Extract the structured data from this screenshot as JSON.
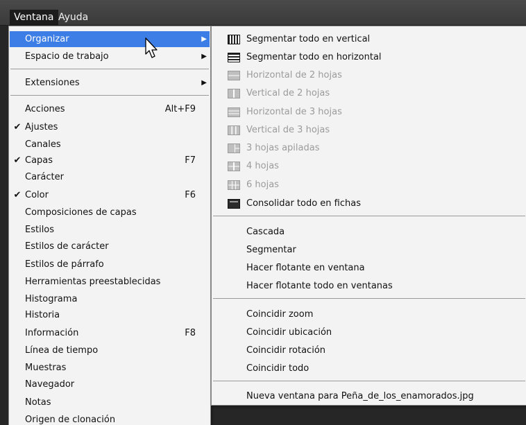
{
  "menubar": {
    "items": [
      "Ventana",
      "Ayuda"
    ]
  },
  "window_menu": {
    "items": [
      {
        "label": "Organizar",
        "submenu": true,
        "highlighted": true
      },
      {
        "label": "Espacio de trabajo",
        "submenu": true
      },
      {
        "label": "Extensiones",
        "submenu": true
      },
      {
        "label": "Acciones",
        "shortcut": "Alt+F9"
      },
      {
        "label": "Ajustes",
        "checked": true
      },
      {
        "label": "Canales"
      },
      {
        "label": "Capas",
        "checked": true,
        "shortcut": "F7"
      },
      {
        "label": "Carácter"
      },
      {
        "label": "Color",
        "checked": true,
        "shortcut": "F6"
      },
      {
        "label": "Composiciones de capas"
      },
      {
        "label": "Estilos"
      },
      {
        "label": "Estilos de carácter"
      },
      {
        "label": "Estilos de párrafo"
      },
      {
        "label": "Herramientas preestablecidas"
      },
      {
        "label": "Histograma"
      },
      {
        "label": "Historia"
      },
      {
        "label": "Información",
        "shortcut": "F8"
      },
      {
        "label": "Línea de tiempo"
      },
      {
        "label": "Muestras"
      },
      {
        "label": "Navegador"
      },
      {
        "label": "Notas"
      },
      {
        "label": "Origen de clonación"
      }
    ],
    "check_mark": "✔",
    "submenu_arrow": "▶"
  },
  "arrange_submenu": {
    "items": [
      {
        "label": "Segmentar todo en vertical",
        "icon": "vertical-tile-icon"
      },
      {
        "label": "Segmentar todo en horizontal",
        "icon": "horizontal-tile-icon"
      },
      {
        "label": "Horizontal de 2 hojas",
        "icon": "two-up-horizontal-icon",
        "disabled": true
      },
      {
        "label": "Vertical de 2 hojas",
        "icon": "two-up-vertical-icon",
        "disabled": true
      },
      {
        "label": "Horizontal de 3 hojas",
        "icon": "three-up-horizontal-icon",
        "disabled": true
      },
      {
        "label": "Vertical de 3 hojas",
        "icon": "three-up-vertical-icon",
        "disabled": true
      },
      {
        "label": "3 hojas apiladas",
        "icon": "three-up-stacked-icon",
        "disabled": true
      },
      {
        "label": "4 hojas",
        "icon": "four-up-icon",
        "disabled": true
      },
      {
        "label": "6 hojas",
        "icon": "six-up-icon",
        "disabled": true
      },
      {
        "label": "Consolidar todo en fichas",
        "icon": "consolidate-tabs-icon"
      },
      {
        "label": "Cascada"
      },
      {
        "label": "Segmentar"
      },
      {
        "label": "Hacer flotante en ventana"
      },
      {
        "label": "Hacer flotante todo en ventanas"
      },
      {
        "label": "Coincidir zoom"
      },
      {
        "label": "Coincidir ubicación"
      },
      {
        "label": "Coincidir rotación"
      },
      {
        "label": "Coincidir todo"
      },
      {
        "label": "Nueva ventana para Peña_de_los_enamorados.jpg"
      }
    ]
  },
  "colors": {
    "highlight": "#3d7ee6",
    "menu_background": "#f3f3f3",
    "menubar_background": "#3a3a3a",
    "disabled_text": "#9b9b9b"
  }
}
